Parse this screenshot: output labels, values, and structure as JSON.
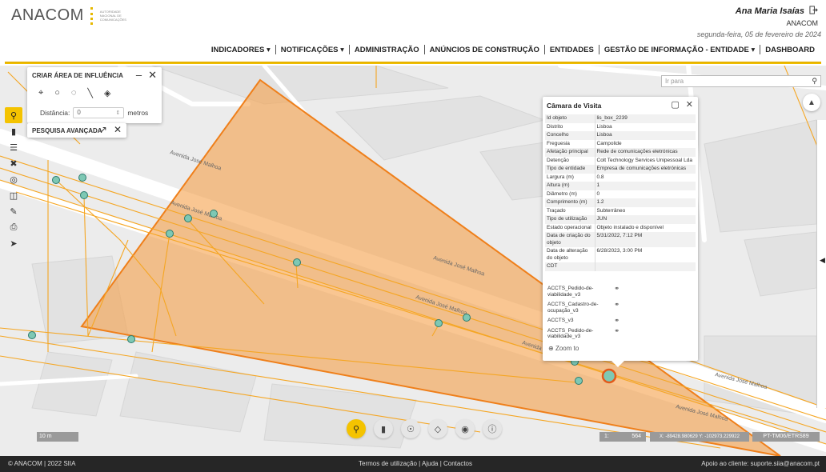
{
  "header": {
    "logo_text": "ANACOM",
    "logo_subtext": "AUTORIDADE NACIONAL DE COMUNICAÇÕES",
    "user_name": "Ana Maria Isaías",
    "user_org": "ANACOM",
    "date": "segunda-feira, 05 de fevereiro de 2024",
    "menu": [
      {
        "label": "INDICADORES ▾"
      },
      {
        "label": "NOTIFICAÇÕES ▾"
      },
      {
        "label": "ADMINISTRAÇÃO"
      },
      {
        "label": "ANÚNCIOS DE CONSTRUÇÃO"
      },
      {
        "label": "ENTIDADES"
      },
      {
        "label": "GESTÃO DE INFORMAÇÃO - ENTIDADE ▾"
      },
      {
        "label": "DASHBOARD"
      }
    ]
  },
  "area_panel": {
    "title": "CRIAR ÁREA DE INFLUÊNCIA",
    "distance_label": "Distância:",
    "distance_value": "0",
    "unit": "metros"
  },
  "search_panel": {
    "title": "PESQUISA AVANÇADA"
  },
  "goto": {
    "placeholder": "Ir para"
  },
  "streets": {
    "s1": "Avenida José Malhoa",
    "s2": "Avenida José Malhoa",
    "s3": "Avenida José Malhoa",
    "s4": "Avenida José Malhoa",
    "s5": "Avenida José Malhoa",
    "s6": "Avenida José Malhoa",
    "s7": "Avenida José Malhoa"
  },
  "popup": {
    "title": "Câmara de Visita",
    "rows": [
      {
        "key": "Id objeto",
        "value": "lis_box_2239"
      },
      {
        "key": "Distrito",
        "value": "Lisboa"
      },
      {
        "key": "Concelho",
        "value": "Lisboa"
      },
      {
        "key": "Freguesia",
        "value": "Campolide"
      },
      {
        "key": "Afetação principal",
        "value": "Rede de comunicações eletrónicas"
      },
      {
        "key": "Detenção",
        "value": "Colt Technology Services Unipessoal Lda"
      },
      {
        "key": "Tipo de entidade",
        "value": "Empresa de comunicações eletrónicas"
      },
      {
        "key": "Largura (m)",
        "value": "0.8"
      },
      {
        "key": "Altura (m)",
        "value": "1"
      },
      {
        "key": "Diâmetro (m)",
        "value": "0"
      },
      {
        "key": "Comprimento (m)",
        "value": "1.2"
      },
      {
        "key": "Traçado",
        "value": "Subterrâneo"
      },
      {
        "key": "Tipo de utilização",
        "value": "JUN"
      },
      {
        "key": "Estado operacional",
        "value": "Objeto instalado e disponível"
      },
      {
        "key": "Data de criação do objeto",
        "value": "5/31/2022, 7:12 PM"
      },
      {
        "key": "Data de alteração do objeto",
        "value": "6/28/2023, 3:00 PM"
      },
      {
        "key": "CDT",
        "value": ""
      }
    ],
    "links": [
      {
        "label": "ACCTS_Pedido-de-viabilidade_v3"
      },
      {
        "label": "ACCTS_Cadastro-de-ocupação_v3"
      },
      {
        "label": "ACCTS_v3"
      },
      {
        "label": "ACCTS_Pedido-de-viabilidade_v3"
      }
    ],
    "zoom_to": "Zoom to"
  },
  "status": {
    "scalebar": "10 m",
    "scale_prefix": "1:",
    "scale_value": "564",
    "coords": "X: -89428.980629 Y: -102973.229922",
    "projection": "PT-TM06/ETRS89"
  },
  "footer": {
    "left": "© ANACOM | 2022 SIIA",
    "center": "Termos de utilização  |  Ajuda  |  Contactos",
    "right": "Apoio ao cliente: suporte.siia@anacom.pt"
  },
  "colors": {
    "accent": "#f4c300",
    "area_fill": "#f5a04a",
    "network_line": "#f5a623",
    "footer_bg": "#262626"
  }
}
